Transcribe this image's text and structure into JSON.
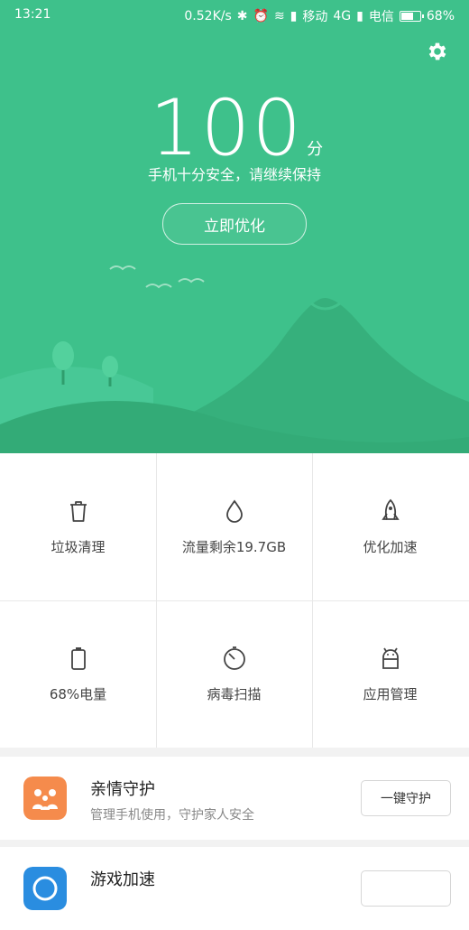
{
  "status_bar": {
    "time": "13:21",
    "network_speed": "0.52K/s",
    "carrier1": "移动",
    "network_type": "4G",
    "carrier2": "电信",
    "battery": "68%"
  },
  "hero": {
    "score": "100",
    "score_unit": "分",
    "subtitle": "手机十分安全，请继续保持",
    "optimize_button": "立即优化"
  },
  "tiles": [
    {
      "label": "垃圾清理",
      "icon": "trash-icon"
    },
    {
      "label": "流量剩余19.7GB",
      "icon": "drop-icon"
    },
    {
      "label": "优化加速",
      "icon": "rocket-icon"
    },
    {
      "label": "68%电量",
      "icon": "battery-icon"
    },
    {
      "label": "病毒扫描",
      "icon": "scan-icon"
    },
    {
      "label": "应用管理",
      "icon": "android-icon"
    }
  ],
  "cards": [
    {
      "title": "亲情守护",
      "desc": "管理手机使用，守护家人安全",
      "button": "一键守护",
      "icon": "family-icon"
    },
    {
      "title": "游戏加速",
      "desc": "",
      "button": "",
      "icon": "game-icon"
    }
  ],
  "colors": {
    "primary_green": "#3ec18b",
    "family_orange": "#f58b4c",
    "game_blue": "#2a8de0"
  }
}
